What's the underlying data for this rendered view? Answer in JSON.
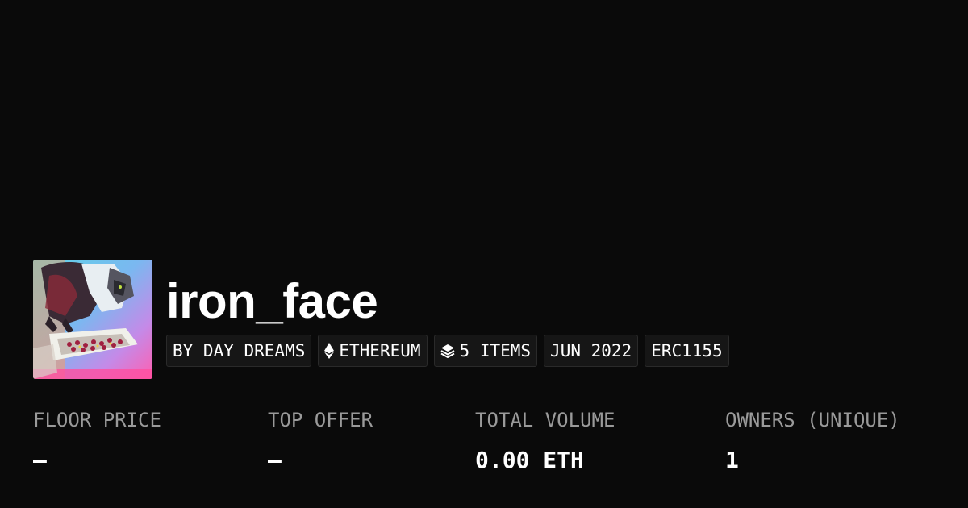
{
  "collection": {
    "name": "iron_face",
    "image_alt": "cat-artwork-thumbnail"
  },
  "tags": {
    "creator": "BY DAY_DREAMS",
    "chain": "ETHEREUM",
    "chain_icon": "ethereum-icon",
    "items": "5 ITEMS",
    "items_icon": "layers-icon",
    "date": "JUN 2022",
    "standard": "ERC1155"
  },
  "stats": {
    "floor_price": {
      "label": "FLOOR PRICE",
      "value": "–"
    },
    "top_offer": {
      "label": "TOP OFFER",
      "value": "–"
    },
    "total_volume": {
      "label": "TOTAL VOLUME",
      "value": "0.00 ETH"
    },
    "owners": {
      "label": "OWNERS (UNIQUE)",
      "value": "1"
    }
  },
  "colors": {
    "background": "#0a0a0a",
    "tag_background": "#161616",
    "label_gray": "#9a9a9a",
    "text": "#ffffff"
  }
}
